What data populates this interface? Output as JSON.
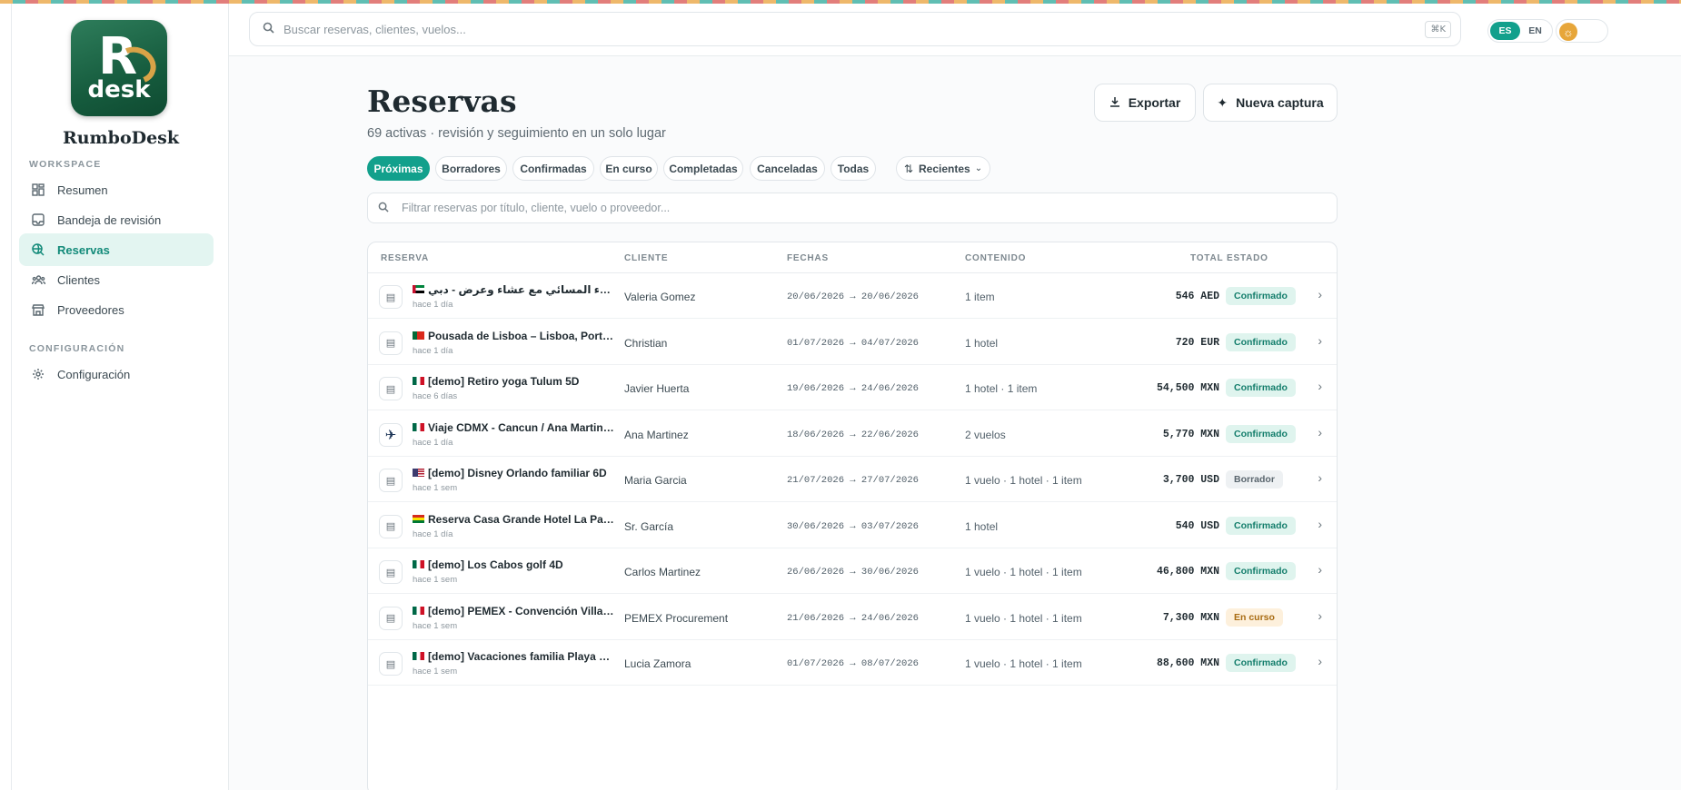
{
  "app": {
    "name": "RumboDesk",
    "logo_letter": "R",
    "logo_word": "desk",
    "accent": "#12a08c"
  },
  "sidebar": {
    "section_workspace": "WORKSPACE",
    "section_config": "CONFIGURACIÓN",
    "items": [
      {
        "label": "Resumen",
        "icon": "grid-icon"
      },
      {
        "label": "Bandeja de revisión",
        "icon": "inbox-icon"
      },
      {
        "label": "Reservas",
        "icon": "search-globe-icon",
        "active": true
      },
      {
        "label": "Clientes",
        "icon": "users-icon"
      },
      {
        "label": "Proveedores",
        "icon": "store-icon"
      }
    ],
    "config_items": [
      {
        "label": "Configuración",
        "icon": "gear-icon"
      }
    ]
  },
  "topbar": {
    "search_placeholder": "Buscar reservas, clientes, vuelos...",
    "shortcut": "⌘K",
    "lang_es": "ES",
    "lang_en": "EN",
    "selected_lang": "ES"
  },
  "page": {
    "title": "Reservas",
    "subtitle": "69 activas · revisión y seguimiento en un solo lugar",
    "export_label": "Exportar",
    "new_capture_label": "Nueva captura"
  },
  "filters": {
    "chips": [
      "Próximas",
      "Borradores",
      "Confirmadas",
      "En curso",
      "Completadas",
      "Canceladas",
      "Todas"
    ],
    "active_chip": "Próximas",
    "sort_label": "Recientes",
    "filter_placeholder": "Filtrar reservas por título, cliente, vuelo o proveedor..."
  },
  "table": {
    "columns": {
      "reserva": "RESERVA",
      "cliente": "CLIENTE",
      "fechas": "FECHAS",
      "contenido": "CONTENIDO",
      "total": "TOTAL",
      "estado": "ESTADO"
    },
    "rows": [
      {
        "flag": "AE",
        "title": "سفاري الصحراء المسائي مع عشاء وعرض - دبي",
        "ago": "hace 1 día",
        "client": "Valeria Gomez",
        "dates": "20/06/2026 → 20/06/2026",
        "content": "1 item",
        "total": "546 AED",
        "status": "Confirmado",
        "status_kind": "ok",
        "tile": "bag"
      },
      {
        "flag": "PT",
        "title": "Pousada de Lisboa – Lisboa, Portugal",
        "ago": "hace 1 día",
        "client": "Christian",
        "dates": "01/07/2026 → 04/07/2026",
        "content": "1 hotel",
        "total": "720 EUR",
        "status": "Confirmado",
        "status_kind": "ok",
        "tile": "bag"
      },
      {
        "flag": "MX",
        "title": "[demo] Retiro yoga Tulum 5D",
        "ago": "hace 6 días",
        "client": "Javier Huerta",
        "dates": "19/06/2026 → 24/06/2026",
        "content": "1 hotel · 1 item",
        "total": "54,500 MXN",
        "status": "Confirmado",
        "status_kind": "ok",
        "tile": "bag"
      },
      {
        "flag": "MX",
        "title": "Viaje CDMX - Cancun / Ana Martinez",
        "ago": "hace 1 día",
        "client": "Ana Martinez",
        "dates": "18/06/2026 → 22/06/2026",
        "content": "2 vuelos",
        "total": "5,770 MXN",
        "status": "Confirmado",
        "status_kind": "ok",
        "tile": "plane"
      },
      {
        "flag": "US",
        "title": "[demo] Disney Orlando familiar 6D",
        "ago": "hace 1 sem",
        "client": "Maria Garcia",
        "dates": "21/07/2026 → 27/07/2026",
        "content": "1 vuelo · 1 hotel · 1 item",
        "total": "3,700 USD",
        "status": "Borrador",
        "status_kind": "draft",
        "tile": "bag"
      },
      {
        "flag": "BO",
        "title": "Reserva Casa Grande Hotel La Paz ...",
        "ago": "hace 1 día",
        "client": "Sr. García",
        "dates": "30/06/2026 → 03/07/2026",
        "content": "1 hotel",
        "total": "540 USD",
        "status": "Confirmado",
        "status_kind": "ok",
        "tile": "bag"
      },
      {
        "flag": "MX",
        "title": "[demo] Los Cabos golf 4D",
        "ago": "hace 1 sem",
        "client": "Carlos Martinez",
        "dates": "26/06/2026 → 30/06/2026",
        "content": "1 vuelo · 1 hotel · 1 item",
        "total": "46,800 MXN",
        "status": "Confirmado",
        "status_kind": "ok",
        "tile": "bag"
      },
      {
        "flag": "MX",
        "title": "[demo] PEMEX - Convención Villah...",
        "ago": "hace 1 sem",
        "client": "PEMEX Procurement",
        "dates": "21/06/2026 → 24/06/2026",
        "content": "1 vuelo · 1 hotel · 1 item",
        "total": "7,300 MXN",
        "status": "En curso",
        "status_kind": "run",
        "tile": "bag"
      },
      {
        "flag": "MX",
        "title": "[demo] Vacaciones familia Playa de...",
        "ago": "hace 1 sem",
        "client": "Lucia Zamora",
        "dates": "01/07/2026 → 08/07/2026",
        "content": "1 vuelo · 1 hotel · 1 item",
        "total": "88,600 MXN",
        "status": "Confirmado",
        "status_kind": "ok",
        "tile": "bag"
      }
    ]
  }
}
